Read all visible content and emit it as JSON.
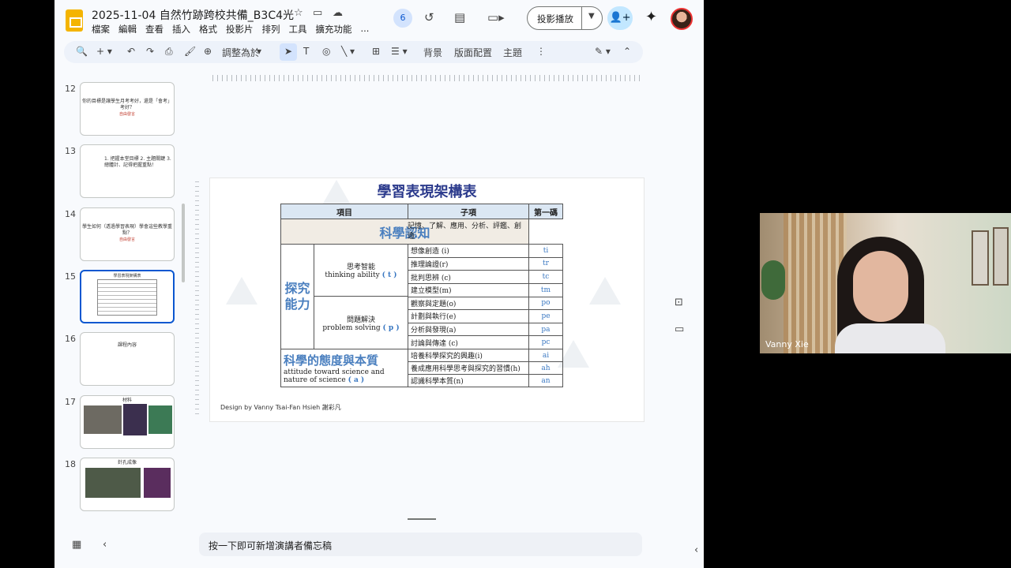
{
  "doc_title": "2025-11-04 自然竹跡跨校共備_B3C4光",
  "menu": [
    "檔案",
    "編輯",
    "查看",
    "插入",
    "格式",
    "投影片",
    "排列",
    "工具",
    "擴充功能",
    "..."
  ],
  "collaborators_count": "6",
  "present_label": "投影播放",
  "toolbar": {
    "zoom_label": "調整為於",
    "background": "背景",
    "layout": "版面配置",
    "theme": "主題"
  },
  "slides": [
    {
      "num": "12",
      "text": "你的目標是讓學生月考考好，還是「會考」考好？",
      "sub": "自由發言"
    },
    {
      "num": "13",
      "text": "1. 把握本堂目標  2. 主題關鍵  3. 總體計、記得把握重點！",
      "sub": ""
    },
    {
      "num": "14",
      "text": "學生如何（透過學習表現）學會這些教學重點？",
      "sub": "自由發言"
    },
    {
      "num": "15",
      "text": "學習表現架構表",
      "sub": ""
    },
    {
      "num": "16",
      "text": "課程內容",
      "sub": ""
    },
    {
      "num": "17",
      "text": "材料",
      "sub": ""
    },
    {
      "num": "18",
      "text": "針孔成像",
      "sub": ""
    }
  ],
  "slide": {
    "title": "學習表現架構表",
    "headers": [
      "項目",
      "子項",
      "第一碼"
    ],
    "science_cognition": "科學認知",
    "science_cognition_desc": "記憶、了解、應用、分析、評鑑、創造",
    "inquiry_line1": "探究",
    "inquiry_line2": "能力",
    "thinking_zh": "思考智能",
    "thinking_en": "thinking ability",
    "thinking_code": "( t )",
    "problem_zh": "問題解決",
    "problem_en": "problem solving",
    "problem_code": "( p )",
    "thinking_items": [
      {
        "name": "想像創造 (i)",
        "code": "ti"
      },
      {
        "name": "推理論證(r)",
        "code": "tr"
      },
      {
        "name": "批判思辨 (c)",
        "code": "tc"
      },
      {
        "name": "建立模型(m)",
        "code": "tm"
      }
    ],
    "problem_items": [
      {
        "name": "觀察與定題(o)",
        "code": "po"
      },
      {
        "name": "計劃與執行(e)",
        "code": "pe"
      },
      {
        "name": "分析與發現(a)",
        "code": "pa"
      },
      {
        "name": "討論與傳達 (c)",
        "code": "pc"
      }
    ],
    "attitude_zh": "科學的態度與本質",
    "attitude_en": "attitude toward science and nature of science",
    "attitude_code": "( a )",
    "attitude_items": [
      {
        "name": "培養科學探究的興趣(i)",
        "code": "ai"
      },
      {
        "name": "養成應用科學思考與探究的習慣(h)",
        "code": "ah"
      },
      {
        "name": "認識科學本質(n)",
        "code": "an"
      }
    ],
    "credit": "Design by Vanny Tsai-Fan Hsieh 謝彩凡"
  },
  "notes_placeholder": "按一下即可新增演講者備忘稿",
  "video": {
    "participant_name": "Vanny Xie"
  },
  "colors": {
    "accent": "#0b57d0",
    "slide_title": "#2b3a8c",
    "slide_blue": "#4a7fbf"
  }
}
